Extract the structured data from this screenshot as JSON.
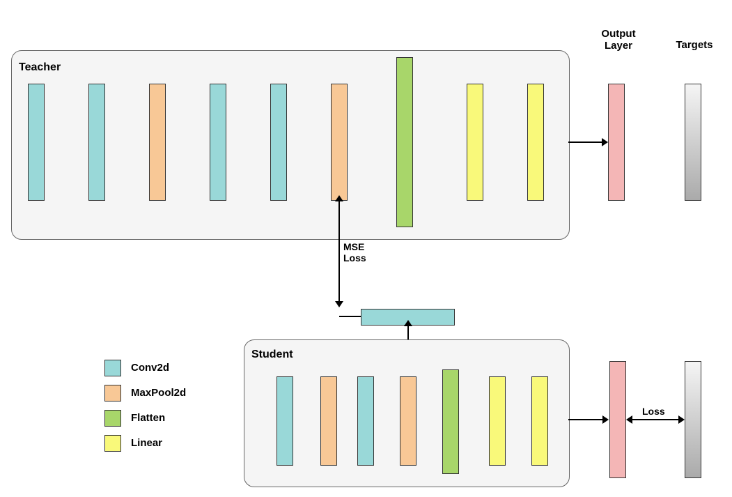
{
  "teacher": {
    "title": "Teacher",
    "layers": [
      {
        "type": "conv2d"
      },
      {
        "type": "conv2d"
      },
      {
        "type": "maxpool2d"
      },
      {
        "type": "conv2d"
      },
      {
        "type": "conv2d"
      },
      {
        "type": "maxpool2d"
      },
      {
        "type": "flatten"
      },
      {
        "type": "linear"
      },
      {
        "type": "linear"
      }
    ]
  },
  "student": {
    "title": "Student",
    "layers": [
      {
        "type": "conv2d"
      },
      {
        "type": "maxpool2d"
      },
      {
        "type": "conv2d"
      },
      {
        "type": "maxpool2d"
      },
      {
        "type": "flatten"
      },
      {
        "type": "linear"
      },
      {
        "type": "linear"
      }
    ]
  },
  "intermediate": {
    "type": "conv2d"
  },
  "headers": {
    "output_layer": "Output\nLayer",
    "targets": "Targets"
  },
  "annotations": {
    "mse_loss": "MSE\nLoss",
    "loss": "Loss"
  },
  "legend": {
    "conv2d": "Conv2d",
    "maxpool2d": "MaxPool2d",
    "flatten": "Flatten",
    "linear": "Linear"
  },
  "colors": {
    "conv2d": "#99d8d8",
    "maxpool2d": "#f8c896",
    "flatten": "#a8d66a",
    "linear": "#f9f97a",
    "output": "#f4b6b6",
    "targets_grad": [
      "#f5f5f5",
      "#aaaaaa"
    ]
  }
}
